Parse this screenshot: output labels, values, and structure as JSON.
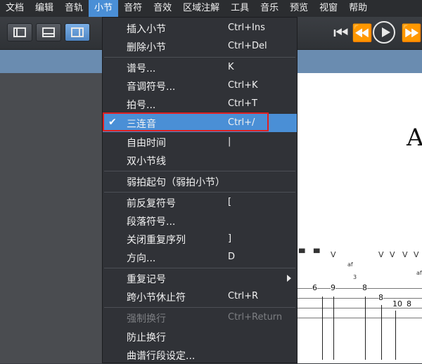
{
  "menubar": {
    "items": [
      {
        "label": "文档"
      },
      {
        "label": "编辑"
      },
      {
        "label": "音轨"
      },
      {
        "label": "小节"
      },
      {
        "label": "音符"
      },
      {
        "label": "音效"
      },
      {
        "label": "区域注解"
      },
      {
        "label": "工具"
      },
      {
        "label": "音乐"
      },
      {
        "label": "预览"
      },
      {
        "label": "视窗"
      },
      {
        "label": "帮助"
      }
    ],
    "active_index": 3
  },
  "toolbar": {
    "view_buttons": [
      "layout-left-icon",
      "layout-bottom-icon",
      "layout-right-icon"
    ],
    "transport": [
      "skip-start-icon",
      "rewind-icon",
      "play-icon",
      "fast-forward-icon"
    ]
  },
  "menu": {
    "items": [
      {
        "label": "插入小节",
        "shortcut": "Ctrl+Ins"
      },
      {
        "label": "删除小节",
        "shortcut": "Ctrl+Del"
      },
      {
        "label": "谱号...",
        "shortcut": "K"
      },
      {
        "label": "音调符号...",
        "shortcut": "Ctrl+K"
      },
      {
        "label": "拍号...",
        "shortcut": "Ctrl+T"
      },
      {
        "label": "三连音",
        "shortcut": "Ctrl+/",
        "checked": true,
        "highlighted": true
      },
      {
        "label": "自由时间",
        "shortcut": "|"
      },
      {
        "label": "双小节线",
        "shortcut": ""
      },
      {
        "label": "弱拍起句（弱拍小节）",
        "shortcut": ""
      },
      {
        "label": "前反复符号",
        "shortcut": "["
      },
      {
        "label": "段落符号...",
        "shortcut": ""
      },
      {
        "label": "关闭重复序列",
        "shortcut": "]"
      },
      {
        "label": "方向...",
        "shortcut": "D"
      },
      {
        "label": "重复记号",
        "shortcut": "",
        "submenu": true
      },
      {
        "label": "跨小节休止符",
        "shortcut": "Ctrl+R"
      },
      {
        "label": "强制换行",
        "shortcut": "Ctrl+Return",
        "disabled": true
      },
      {
        "label": "防止换行",
        "shortcut": ""
      },
      {
        "label": "曲谱行段设定...",
        "shortcut": ""
      }
    ]
  },
  "score": {
    "title_letter": "A",
    "tab_numbers": [
      "6",
      "9",
      "8",
      "8",
      "10",
      "8"
    ],
    "marks_top": [
      "V",
      "V",
      "V",
      "V",
      "V"
    ],
    "dynamics": [
      "af",
      "af"
    ],
    "small_mark": "3"
  },
  "colors": {
    "highlight": "#4a8fd6",
    "annotation_box": "#e02020"
  }
}
